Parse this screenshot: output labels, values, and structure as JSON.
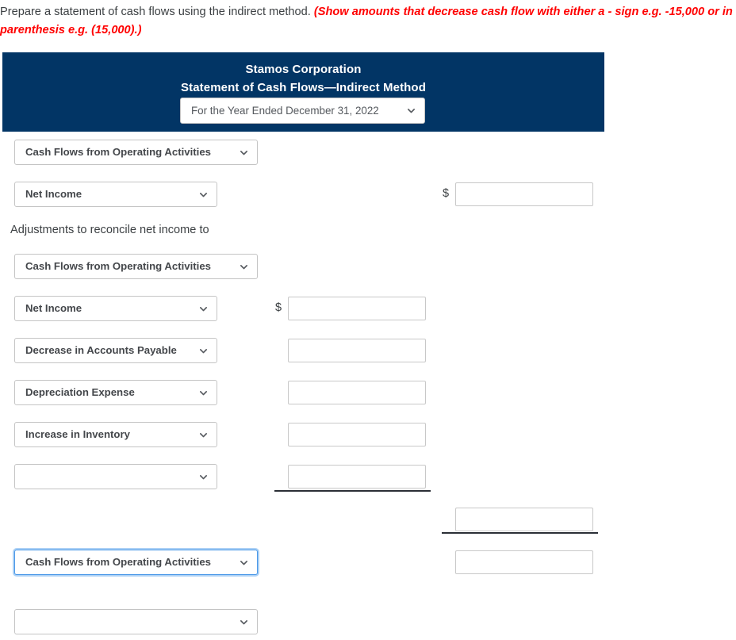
{
  "instructions": {
    "main_text": "Prepare a statement of cash flows using the indirect method. ",
    "emphasis_text": "(Show amounts that decrease cash flow with either a - sign e.g. -15,000 or in parenthesis e.g. (15,000).)",
    "emphasis_color": "#ff0000"
  },
  "statement_header": {
    "company_name": "Stamos Corporation",
    "statement_title": "Statement of Cash Flows—Indirect Method",
    "background_color": "#023565",
    "text_color": "#ffffff",
    "period_select": {
      "value": "For the Year Ended December 31, 2022",
      "icon": "chevron-down-icon"
    }
  },
  "rows": [
    {
      "id": "section-operating-1",
      "select_value": "Cash Flows from Operating Activities",
      "icon": "chevron-down-icon",
      "focused": false
    },
    {
      "id": "net-income-1",
      "select_value": "Net Income",
      "icon": "chevron-down-icon",
      "dollar_sign": "$",
      "amount_value": "",
      "focused": false
    },
    {
      "id": "adjustments-label",
      "label": "Adjustments to reconcile net income to"
    },
    {
      "id": "section-operating-2",
      "select_value": "Cash Flows from Operating Activities",
      "icon": "chevron-down-icon",
      "focused": false
    },
    {
      "id": "net-income-2",
      "select_value": "Net Income",
      "icon": "chevron-down-icon",
      "dollar_sign": "$",
      "amount_value": "",
      "focused": false
    },
    {
      "id": "decrease-accounts-payable",
      "select_value": "Decrease in Accounts Payable",
      "icon": "chevron-down-icon",
      "amount_value": "",
      "focused": false
    },
    {
      "id": "depreciation-expense",
      "select_value": "Depreciation Expense",
      "icon": "chevron-down-icon",
      "amount_value": "",
      "focused": false
    },
    {
      "id": "increase-inventory",
      "select_value": "Increase in Inventory",
      "icon": "chevron-down-icon",
      "amount_value": "",
      "focused": false
    },
    {
      "id": "blank-adjustment",
      "select_value": "",
      "icon": "chevron-down-icon",
      "amount_value": "",
      "focused": false
    },
    {
      "id": "subtotal-adjustments",
      "amount_value": ""
    },
    {
      "id": "section-operating-3",
      "select_value": "Cash Flows from Operating Activities",
      "icon": "chevron-down-icon",
      "amount_value": "",
      "focused": true
    },
    {
      "id": "blank-section-bottom",
      "select_value": "",
      "icon": "chevron-down-icon",
      "focused": false
    }
  ]
}
